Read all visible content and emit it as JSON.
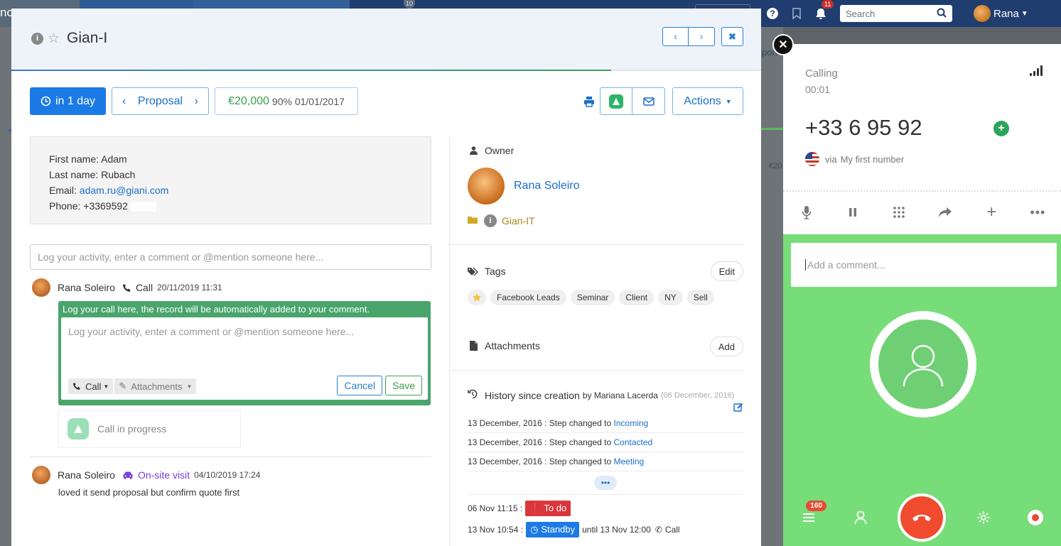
{
  "topnav": {
    "brand_fragment": "nc",
    "notification_count_top": "10",
    "bell_count": "11",
    "search_placeholder": "Search",
    "user_name": "Rana"
  },
  "background": {
    "right_text": "port",
    "right_amount": "€20"
  },
  "modal": {
    "title": "Gian-I",
    "progress": 0.8,
    "due_label": "in 1 day",
    "stage_label": "Proposal",
    "amount": "€20,000",
    "probability_date": "90% 01/01/2017",
    "actions_label": "Actions"
  },
  "contact": {
    "first_name_line": "First name: Adam",
    "last_name_line": "Last name: Rubach",
    "email_label": "Email: ",
    "email": "adam.ru@giani.com",
    "phone_line": "Phone: +3369592"
  },
  "activity": {
    "input_placeholder": "Log your activity, enter a comment or @mention someone here...",
    "entries": [
      {
        "author": "Rana Soleiro",
        "type": "Call",
        "timestamp": "20/11/2019 11:31",
        "hint": "Log your call here, the record will be automatically added to your comment.",
        "inner_placeholder": "Log your activity, enter a comment or @mention someone here...",
        "call_chip": "Call",
        "attachments_chip": "Attachments",
        "cancel_label": "Cancel",
        "save_label": "Save",
        "in_progress_label": "Call in progress"
      },
      {
        "author": "Rana Soleiro",
        "type": "On-site visit",
        "timestamp": "04/10/2019 17:24",
        "text": "loved it send proposal but confirm quote first"
      }
    ]
  },
  "owner": {
    "section_title": "Owner",
    "name": "Rana Soleiro",
    "org": "Gian-IT"
  },
  "tags": {
    "section_title": "Tags",
    "edit_label": "Edit",
    "items": [
      "Facebook Leads",
      "Seminar",
      "Client",
      "NY",
      "Sell"
    ]
  },
  "attachments": {
    "section_title": "Attachments",
    "add_label": "Add"
  },
  "history": {
    "title": "History since creation",
    "by": "by Mariana Lacerda",
    "date": "(06 December, 2016)",
    "lines": [
      {
        "date": "13 December, 2016",
        "text": "Step changed to",
        "step": "Incoming"
      },
      {
        "date": "13 December, 2016",
        "text": "Step changed to",
        "step": "Contacted"
      },
      {
        "date": "13 December, 2016",
        "text": "Step changed to",
        "step": "Meeting"
      }
    ],
    "more": "•••",
    "status1": {
      "time": "06 Nov 11:15 :",
      "badge": "To do"
    },
    "status2": {
      "time": "13 Nov 10:54 :",
      "badge": "Standby",
      "rest": "until 13 Nov 12:00",
      "type": "Call"
    }
  },
  "dialer": {
    "status": "Calling",
    "timer": "00:01",
    "number": "+33 6 95 92",
    "via": "via",
    "line": "My first number",
    "comment_placeholder": "Add a comment...",
    "badge_count": "160",
    "colors": {
      "green": "#77dd78",
      "hangup": "#f04b2f"
    }
  }
}
